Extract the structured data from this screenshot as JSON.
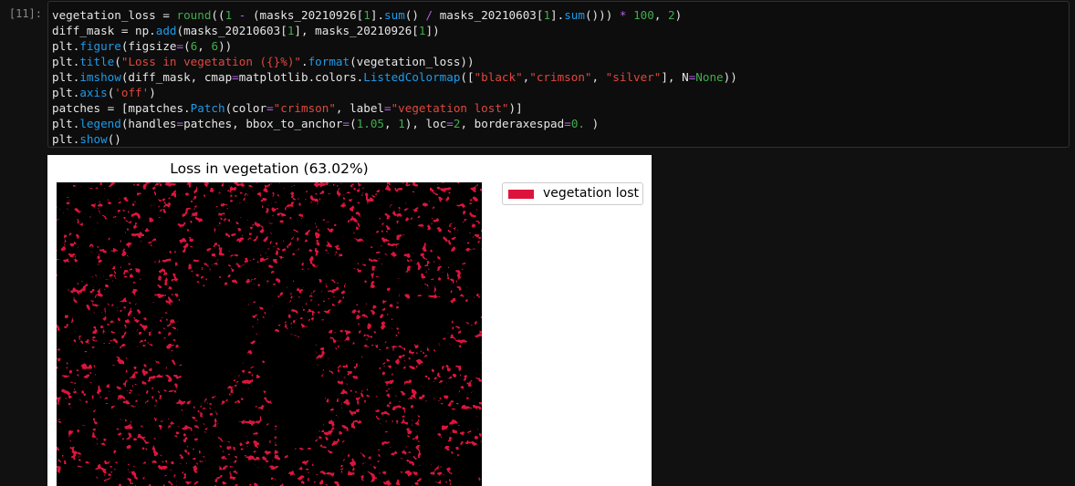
{
  "cell": {
    "prompt": "[11]:"
  },
  "code": {
    "line1": {
      "a": "vegetation_loss = ",
      "b": "round",
      "c": "((",
      "d": "1",
      "e": " ",
      "f": "-",
      "g": " (masks_20210926[",
      "h": "1",
      "i": "].",
      "j": "sum",
      "k": "() ",
      "l": "/",
      "m": " masks_20210603[",
      "n": "1",
      "o": "].",
      "p": "sum",
      "q": "())) ",
      "r": "*",
      "s": " ",
      "t": "100",
      "u": ", ",
      "v": "2",
      "w": ")"
    },
    "line2": {
      "a": "diff_mask = np.",
      "b": "add",
      "c": "(masks_20210603[",
      "d": "1",
      "e": "], masks_20210926[",
      "f": "1",
      "g": "])"
    },
    "line3": {
      "a": "plt.",
      "b": "figure",
      "c": "(figsize",
      "d": "=",
      "e": "(",
      "f": "6",
      "g": ", ",
      "h": "6",
      "i": "))"
    },
    "line4": {
      "a": "plt.",
      "b": "title",
      "c": "(",
      "d": "\"Loss in vegetation ({}%)\"",
      "e": ".",
      "f": "format",
      "g": "(vegetation_loss))"
    },
    "line5": {
      "a": "plt.",
      "b": "imshow",
      "c": "(diff_mask, cmap",
      "d": "=",
      "e": "matplotlib.colors.",
      "f": "ListedColormap",
      "g": "([",
      "h": "\"black\"",
      "i": ",",
      "j": "\"crimson\"",
      "k": ", ",
      "l": "\"silver\"",
      "m": "], N",
      "n": "=",
      "o": "None",
      "p": "))"
    },
    "line6": {
      "a": "plt.",
      "b": "axis",
      "c": "(",
      "d": "'off'",
      "e": ")"
    },
    "line7": {
      "a": "patches = [mpatches.",
      "b": "Patch",
      "c": "(color",
      "d": "=",
      "e": "\"crimson\"",
      "f": ", label",
      "g": "=",
      "h": "\"vegetation lost\"",
      "i": ")]"
    },
    "line8": {
      "a": "plt.",
      "b": "legend",
      "c": "(handles",
      "d": "=",
      "e": "patches, bbox_to_anchor",
      "f": "=",
      "g": "(",
      "h": "1.05",
      "i": ", ",
      "j": "1",
      "k": "), loc",
      "l": "=",
      "m": "2",
      "n": ", borderaxespad",
      "o": "=",
      "p": "0.",
      "q": " )"
    },
    "line9": {
      "a": "plt.",
      "b": "show",
      "c": "()"
    }
  },
  "output": {
    "title": "Loss in vegetation (63.02%)",
    "legend_label": "vegetation lost",
    "colors": {
      "lost": "#dc143c",
      "kept": "#c0c0c0",
      "none": "#000000"
    }
  }
}
